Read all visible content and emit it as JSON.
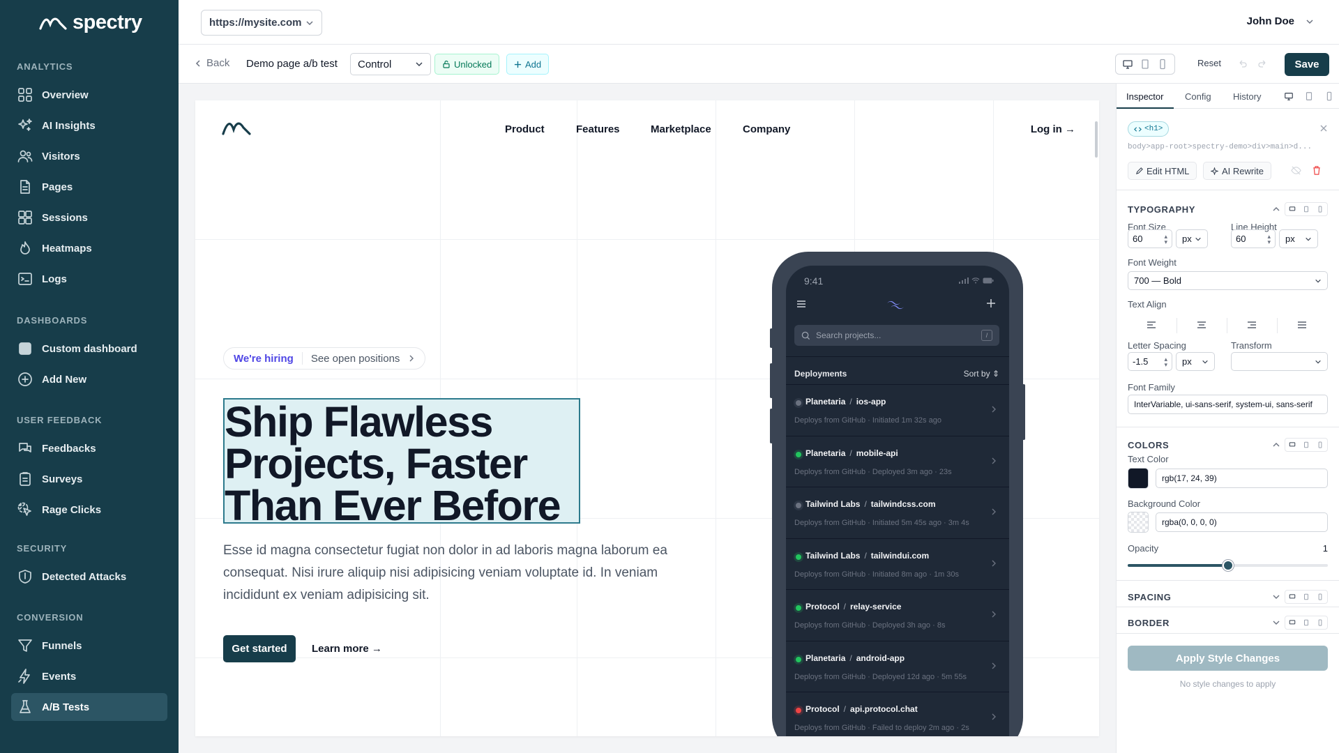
{
  "brand": {
    "name": "spectry"
  },
  "sidebar": {
    "sections": [
      {
        "title": "ANALYTICS",
        "items": [
          {
            "label": "Overview",
            "icon": "grid-icon"
          },
          {
            "label": "AI Insights",
            "icon": "sparkles-icon"
          },
          {
            "label": "Visitors",
            "icon": "users-icon"
          },
          {
            "label": "Pages",
            "icon": "document-icon"
          },
          {
            "label": "Sessions",
            "icon": "squares-icon"
          },
          {
            "label": "Heatmaps",
            "icon": "flame-icon"
          },
          {
            "label": "Logs",
            "icon": "terminal-icon"
          }
        ]
      },
      {
        "title": "DASHBOARDS",
        "items": [
          {
            "label": "Custom dashboard",
            "icon": "square-icon"
          },
          {
            "label": "Add New",
            "icon": "plus-circle-icon"
          }
        ]
      },
      {
        "title": "USER FEEDBACK",
        "items": [
          {
            "label": "Feedbacks",
            "icon": "chat-icon"
          },
          {
            "label": "Surveys",
            "icon": "clipboard-icon"
          },
          {
            "label": "Rage Clicks",
            "icon": "cursor-click-icon"
          }
        ]
      },
      {
        "title": "SECURITY",
        "items": [
          {
            "label": "Detected Attacks",
            "icon": "shield-icon"
          }
        ]
      },
      {
        "title": "CONVERSION",
        "items": [
          {
            "label": "Funnels",
            "icon": "funnel-icon"
          },
          {
            "label": "Events",
            "icon": "bolt-icon"
          },
          {
            "label": "A/B Tests",
            "icon": "flask-icon",
            "active": true
          }
        ]
      }
    ]
  },
  "topbar": {
    "url": "https://mysite.com",
    "user": "John Doe"
  },
  "toolbar": {
    "back": "Back",
    "page_name": "Demo page a/b test",
    "variant": "Control",
    "lock_status": "Unlocked",
    "add": "Add",
    "reset": "Reset",
    "save": "Save"
  },
  "site": {
    "nav": [
      "Product",
      "Features",
      "Marketplace",
      "Company"
    ],
    "login": "Log in →",
    "hiring": "We're hiring",
    "positions": "See open positions",
    "headline": "Ship Flawless Projects, Faster Than Ever Before",
    "body": "Esse id magna consectetur fugiat non dolor in ad laboris magna laborum ea consequat. Nisi irure aliquip nisi adipisicing veniam voluptate id. In veniam incididunt ex veniam adipisicing sit.",
    "cta_primary": "Get started",
    "cta_secondary": "Learn more →"
  },
  "phone": {
    "time": "9:41",
    "search_placeholder": "Search projects...",
    "search_kbd": "/",
    "deployments_title": "Deployments",
    "sort_label": "Sort by",
    "deployments": [
      {
        "org": "Planetaria",
        "repo": "ios-app",
        "source": "Deploys from GitHub",
        "status_text": "Initiated 1m 32s ago",
        "duration": "",
        "status": "pending"
      },
      {
        "org": "Planetaria",
        "repo": "mobile-api",
        "source": "Deploys from GitHub",
        "status_text": "Deployed 3m ago",
        "duration": "23s",
        "status": "success"
      },
      {
        "org": "Tailwind Labs",
        "repo": "tailwindcss.com",
        "source": "Deploys from GitHub",
        "status_text": "Initiated 5m 45s ago",
        "duration": "3m 4s",
        "status": "pending"
      },
      {
        "org": "Tailwind Labs",
        "repo": "tailwindui.com",
        "source": "Deploys from GitHub",
        "status_text": "Initiated 8m ago",
        "duration": "1m 30s",
        "status": "success"
      },
      {
        "org": "Protocol",
        "repo": "relay-service",
        "source": "Deploys from GitHub",
        "status_text": "Deployed 3h ago",
        "duration": "8s",
        "status": "success"
      },
      {
        "org": "Planetaria",
        "repo": "android-app",
        "source": "Deploys from GitHub",
        "status_text": "Deployed 12d ago",
        "duration": "5m 55s",
        "status": "success"
      },
      {
        "org": "Protocol",
        "repo": "api.protocol.chat",
        "source": "Deploys from GitHub",
        "status_text": "Failed to deploy 2m ago",
        "duration": "2s",
        "status": "error"
      }
    ],
    "status_colors": {
      "pending": "#6b7280",
      "success": "#22c55e",
      "error": "#ef4444"
    }
  },
  "inspector": {
    "tabs": [
      "Inspector",
      "Config",
      "History"
    ],
    "active_tab": "Inspector",
    "tag": "<h1>",
    "selector": "body>app-root>spectry-demo>div>main>d...",
    "edit_html": "Edit HTML",
    "ai_rewrite": "AI Rewrite",
    "typography": {
      "title": "TYPOGRAPHY",
      "font_size_label": "Font Size",
      "font_size": "60",
      "font_size_unit": "px",
      "line_height_label": "Line Height",
      "line_height": "60",
      "line_height_unit": "px",
      "font_weight_label": "Font Weight",
      "font_weight": "700 — Bold",
      "text_align_label": "Text Align",
      "letter_spacing_label": "Letter Spacing",
      "letter_spacing": "-1.5",
      "letter_spacing_unit": "px",
      "transform_label": "Transform",
      "transform": "",
      "font_family_label": "Font Family",
      "font_family": "InterVariable, ui-sans-serif, system-ui, sans-serif"
    },
    "colors": {
      "title": "COLORS",
      "text_color_label": "Text Color",
      "text_color": "rgb(17, 24, 39)",
      "bg_color_label": "Background Color",
      "bg_color": "rgba(0, 0, 0, 0)",
      "opacity_label": "Opacity",
      "opacity": "1",
      "opacity_slider": 0.5
    },
    "spacing_title": "SPACING",
    "border_title": "BORDER",
    "apply": "Apply Style Changes",
    "apply_note": "No style changes to apply"
  },
  "colors": {
    "accent": "#173d4a",
    "selection": "#def0f3",
    "sidebar_active": "#2c5564"
  }
}
